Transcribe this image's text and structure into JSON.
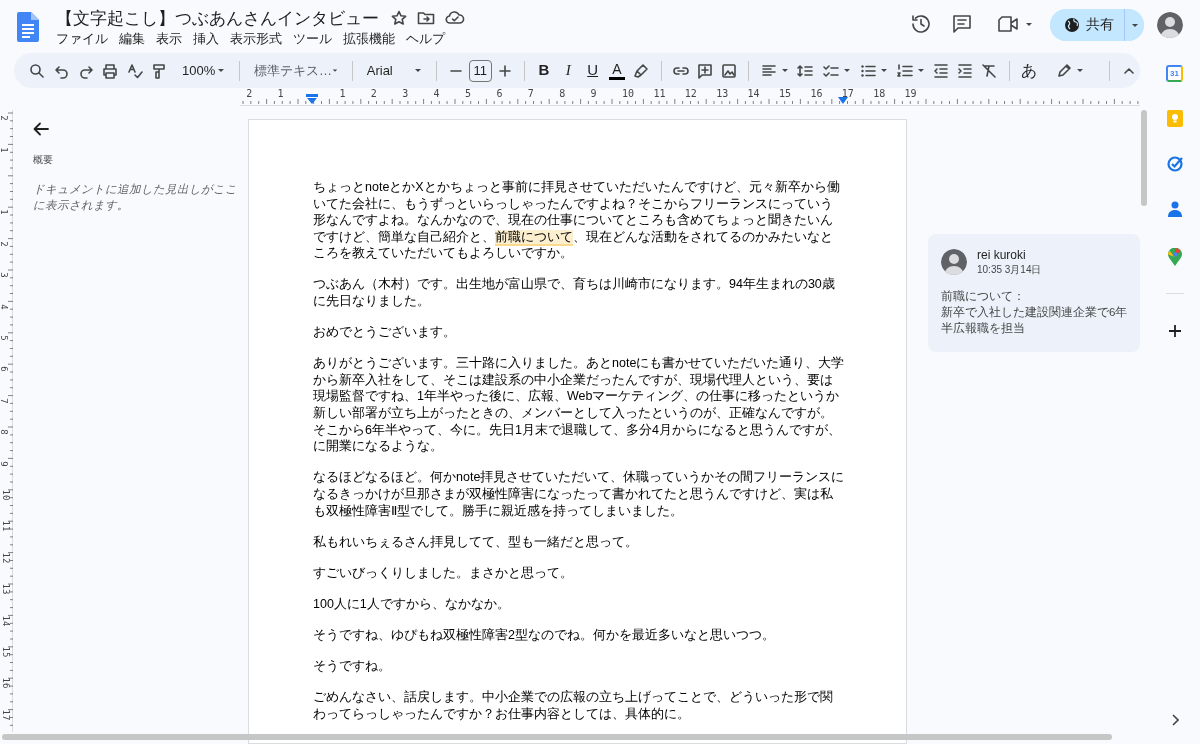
{
  "window": {
    "title": "【文字起こし】つぶあんさんインタビュー",
    "share_label": "共有"
  },
  "menus": [
    "ファイル",
    "編集",
    "表示",
    "挿入",
    "表示形式",
    "ツール",
    "拡張機能",
    "ヘルプ"
  ],
  "toolbar": {
    "zoom": "100%",
    "style": "標準テキス…",
    "font": "Arial",
    "font_size": "11",
    "bold": "B",
    "italic": "I",
    "underline": "U",
    "text_color": "A",
    "input_tools": "あ"
  },
  "ruler": {
    "left_labels": [
      "2",
      "1"
    ],
    "right_labels": [
      "1",
      "2",
      "3",
      "4",
      "5",
      "6",
      "7",
      "8",
      "9",
      "10",
      "11",
      "12",
      "13",
      "14",
      "15",
      "16",
      "17",
      "18",
      "19"
    ],
    "vertical_top_labels": [
      "2",
      "1"
    ],
    "vertical_labels": [
      "1",
      "2",
      "3",
      "4",
      "5",
      "6",
      "7",
      "8",
      "9",
      "10",
      "11",
      "12",
      "13",
      "14",
      "15",
      "16",
      "17"
    ]
  },
  "outline": {
    "heading": "概要",
    "hint": "ドキュメントに追加した見出しがここに表示されます。"
  },
  "document": {
    "paragraphs": [
      {
        "segments": [
          {
            "text": "ちょっとnoteとかXとかちょっと事前に拝見させていただいたんですけど、元々新卒から働いてた会社に、もうずっといらっしゃったんですよね？そこからフリーランスにっていう形なんですよね。なんかなので、現在の仕事についてところも含めてちょっと聞きたいんですけど、簡単な自己紹介と、",
            "commented": false
          },
          {
            "text": "前職について",
            "commented": true
          },
          {
            "text": "、現在どんな活動をされてるのかみたいなところを教えていただいてもよろしいですか。",
            "commented": false
          }
        ]
      },
      {
        "segments": [
          {
            "text": "つぶあん（木村）です。出生地が富山県で、育ちは川崎市になります。94年生まれの30歳に先日なりました。",
            "commented": false
          }
        ]
      },
      {
        "segments": [
          {
            "text": "おめでとうございます。",
            "commented": false
          }
        ]
      },
      {
        "segments": [
          {
            "text": "ありがとうございます。三十路に入りました。あとnoteにも書かせていただいた通り、大学から新卒入社をして、そこは建設系の中小企業だったんですが、現場代理人という、要は現場監督ですね、1年半やった後に、広報、Webマーケティング、の仕事に移ったというか新しい部署が立ち上がったときの、メンバーとして入ったというのが、正確なんですが。そこから6年半やって、今に。先日1月末で退職して、多分4月からになると思うんですが、に開業になるような。",
            "commented": false
          }
        ]
      },
      {
        "segments": [
          {
            "text": "なるほどなるほど。何かnote拝見させていただいて、休職っていうかその間フリーランスになるきっかけが旦那さまが双極性障害になったって書かれてたと思うんですけど、実は私も双極性障害Ⅱ型でして。勝手に親近感を持ってしまいました。",
            "commented": false
          }
        ]
      },
      {
        "segments": [
          {
            "text": "私もれいちぇるさん拝見してて、型も一緒だと思って。",
            "commented": false
          }
        ]
      },
      {
        "segments": [
          {
            "text": "すごいびっくりしました。まさかと思って。",
            "commented": false
          }
        ]
      },
      {
        "segments": [
          {
            "text": "100人に1人ですから、なかなか。",
            "commented": false
          }
        ]
      },
      {
        "segments": [
          {
            "text": "そうですね、ゆぴもね双極性障害2型なのでね。何かを最近多いなと思いつつ。",
            "commented": false
          }
        ]
      },
      {
        "segments": [
          {
            "text": "そうですね。",
            "commented": false
          }
        ]
      },
      {
        "segments": [
          {
            "text": "ごめんなさい、話戻します。中小企業での広報の立ち上げってことで、どういった形で関わってらっしゃったんですか？お仕事内容としては、具体的に。",
            "commented": false
          }
        ]
      }
    ]
  },
  "comment": {
    "author": "rei kuroki",
    "time": "10:35 3月14日",
    "body_lines": [
      "前職について：",
      "新卒で入社した建設関連企業で6年半広報職を担当"
    ]
  },
  "side_panel": {
    "calendar_day": "31"
  }
}
